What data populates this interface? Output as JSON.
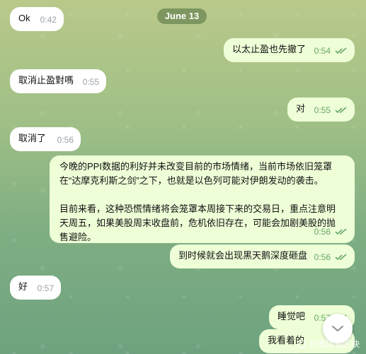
{
  "date_divider": "June 13",
  "messages": [
    {
      "text": "Ok",
      "time": "0:42",
      "dir": "in"
    },
    {
      "text": "以太止盈也先撤了",
      "time": "0:54",
      "dir": "out"
    },
    {
      "text": "取消止盈對嗎",
      "time": "0:55",
      "dir": "in"
    },
    {
      "text": "对",
      "time": "0:55",
      "dir": "out"
    },
    {
      "text": "取消了",
      "time": "0:56",
      "dir": "in"
    },
    {
      "text": "今晚的PPI数据的利好并未改变目前的市场情绪，当前市场依旧笼罩在“达摩克利斯之剑”之下，也就是以色列可能对伊朗发动的袭击。\n\n目前来看，这种恐慌情绪将会笼罩本周接下来的交易日，重点注意明天周五，如果美股周末收盘前，危机依旧存在，可能会加剧美股的抛售避险。",
      "time": "0:56",
      "dir": "out"
    },
    {
      "text": "到时候就会出现黑天鹅深度砸盘",
      "time": "0:56",
      "dir": "out"
    },
    {
      "text": "好",
      "time": "0:57",
      "dir": "in"
    },
    {
      "text": "睡觉吧",
      "time": "0:57",
      "dir": "out"
    },
    {
      "text": "我看着的",
      "time": "",
      "dir": "out"
    }
  ],
  "scroll_down_icon": "chevron-down-icon",
  "watermark": "@虚拟说区块",
  "colors": {
    "incoming": "#ffffff",
    "outgoing": "#eefed7",
    "read_check": "#6aa66a"
  }
}
